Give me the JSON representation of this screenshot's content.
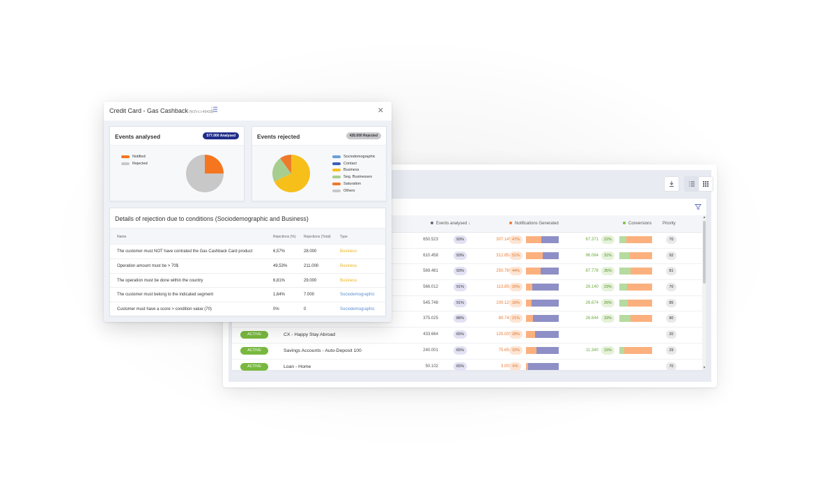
{
  "back_window": {
    "columns": {
      "events_analysed": "Events analysed",
      "sort_icon": "↓",
      "notifications": "Notifications Generated",
      "conversions": "Conversions",
      "priority": "Priority"
    },
    "rows": [
      {
        "status": "",
        "name": "",
        "events": "650.523",
        "events_pct": "93%",
        "notif": "307.145",
        "notif_pct": "47%",
        "notif_bar": 0.47,
        "conv": "67.371",
        "conv_pct": "22%",
        "conv_bar": 0.22,
        "priority": "70"
      },
      {
        "status": "",
        "name": "",
        "events": "610.458",
        "events_pct": "93%",
        "notif": "312.854",
        "notif_pct": "51%",
        "notif_bar": 0.51,
        "conv": "96.064",
        "conv_pct": "31%",
        "conv_bar": 0.31,
        "priority": "92"
      },
      {
        "status": "",
        "name": "",
        "events": "569.481",
        "events_pct": "93%",
        "notif": "250.789",
        "notif_pct": "44%",
        "notif_bar": 0.44,
        "conv": "87.778",
        "conv_pct": "35%",
        "conv_bar": 0.35,
        "priority": "81"
      },
      {
        "status": "",
        "name": "",
        "events": "566.012",
        "events_pct": "91%",
        "notif": "113.854",
        "notif_pct": "20%",
        "notif_bar": 0.2,
        "conv": "26.140",
        "conv_pct": "23%",
        "conv_bar": 0.23,
        "priority": "70"
      },
      {
        "status": "",
        "name": "",
        "events": "545.748",
        "events_pct": "91%",
        "notif": "100.123",
        "notif_pct": "18%",
        "notif_bar": 0.18,
        "conv": "26.674",
        "conv_pct": "26%",
        "conv_bar": 0.26,
        "priority": "85"
      },
      {
        "status": "",
        "name": "",
        "events": "375.025",
        "events_pct": "88%",
        "notif": "80.741",
        "notif_pct": "21%",
        "notif_bar": 0.21,
        "conv": "26.644",
        "conv_pct": "33%",
        "conv_bar": 0.33,
        "priority": "80"
      },
      {
        "status": "ACTIVE",
        "name": "CX - Happy Stay Abroad",
        "events": "433.664",
        "events_pct": "65%",
        "notif": "125.035",
        "notif_pct": "28%",
        "notif_bar": 0.28,
        "conv": "",
        "conv_pct": "",
        "conv_bar": null,
        "priority": "20"
      },
      {
        "status": "ACTIVE",
        "name": "Savings Accounts - Auto-Deposit 100",
        "events": "240.001",
        "events_pct": "65%",
        "notif": "75.654",
        "notif_pct": "32%",
        "notif_bar": 0.32,
        "conv": "11.340",
        "conv_pct": "15%",
        "conv_bar": 0.15,
        "priority": "29"
      },
      {
        "status": "ACTIVE",
        "name": "Loan - Home",
        "events": "50.102",
        "events_pct": "65%",
        "notif": "3.003",
        "notif_pct": "6%",
        "notif_bar": 0.06,
        "conv": "",
        "conv_pct": "",
        "conv_bar": null,
        "priority": "70"
      }
    ],
    "colors": {
      "active": "#78b83f",
      "events_dot": "#666677",
      "notif_dot": "#ea7b33",
      "conv_dot": "#7cbf45"
    }
  },
  "modal": {
    "title": "Credit Card - Gas Cashback",
    "code": "(NOV-LI-49432)",
    "events_analysed": {
      "title": "Events analysed",
      "badge": "577.000 Analysed",
      "legend": [
        {
          "label": "Notified",
          "color": "#f5761e"
        },
        {
          "label": "Rejected",
          "color": "#c8c8c8"
        }
      ],
      "slices": [
        {
          "label": "Notified",
          "value": 25,
          "color": "#f5761e"
        },
        {
          "label": "Rejected",
          "value": 75,
          "color": "#c8c8c8"
        }
      ]
    },
    "events_rejected": {
      "title": "Events rejected",
      "badge": "426.000 Rejected",
      "legend": [
        {
          "label": "Sociodemographic",
          "color": "#6a9fd8"
        },
        {
          "label": "Contact",
          "color": "#3d5fb8"
        },
        {
          "label": "Business",
          "color": "#f6bf1a"
        },
        {
          "label": "Seg. Businesses",
          "color": "#a7cd8f"
        },
        {
          "label": "Saturation",
          "color": "#ec7a2a"
        },
        {
          "label": "Others",
          "color": "#c8c8c8"
        }
      ],
      "slices": [
        {
          "label": "Business",
          "value": 68,
          "color": "#f6bf1a"
        },
        {
          "label": "Seg. Businesses",
          "value": 22,
          "color": "#a7cd8f"
        },
        {
          "label": "Saturation",
          "value": 10,
          "color": "#ec7a2a"
        }
      ]
    },
    "details": {
      "title": "Details of rejection due to conditions (Sociodemographic and Business)",
      "headers": {
        "name": "Name",
        "pct": "Rejections (%)",
        "total": "Rejections (Total)",
        "type": "Type"
      },
      "rows": [
        {
          "name": "The customer must NOT have contrated the Gas Cashback Card product",
          "pct": "6,57%",
          "total": "28.000",
          "type": "Business"
        },
        {
          "name": "Operation amount must be > 70$",
          "pct": "49,53%",
          "total": "211.000",
          "type": "Business"
        },
        {
          "name": "The operation must be done within the country",
          "pct": "6,81%",
          "total": "29.000",
          "type": "Business"
        },
        {
          "name": "The customer must belong to the indicated segment",
          "pct": "1,64%",
          "total": "7.000",
          "type": "Sociodemographic"
        },
        {
          "name": "Customer must have a score > condition value (70)",
          "pct": "0%",
          "total": "0",
          "type": "Sociodemographic"
        }
      ]
    }
  }
}
